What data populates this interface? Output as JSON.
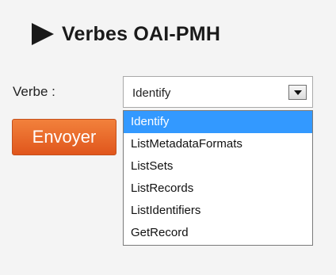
{
  "heading": {
    "title": "Verbes OAI-PMH",
    "icon": "play-triangle-icon"
  },
  "form": {
    "verb_label": "Verbe :",
    "selected_verb": "Identify",
    "submit_label": "Envoyer"
  },
  "dropdown": {
    "options": [
      "Identify",
      "ListMetadataFormats",
      "ListSets",
      "ListRecords",
      "ListIdentifiers",
      "GetRecord"
    ],
    "highlighted": "Identify"
  },
  "colors": {
    "button_orange": "#e8682a",
    "highlight_blue": "#3399ff",
    "panel_background": "#f4f4f4"
  }
}
